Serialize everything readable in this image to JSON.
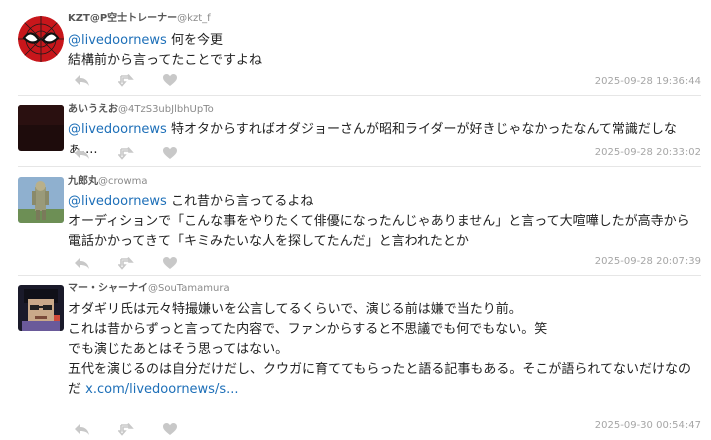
{
  "tweets": [
    {
      "name": "KZT@P空士トレーナー",
      "handle": "@kzt_f",
      "mention": "@livedoornews",
      "lines": [
        "何を今更",
        "結構前から言ってたことですよね"
      ],
      "link": "",
      "timestamp": "2025-09-28 19:36:44",
      "avatar": "spiderman-avatar"
    },
    {
      "name": "あいうえお",
      "handle": "@4TzS3ubJlbhUpTo",
      "mention": "@livedoornews",
      "lines": [
        "特オタからすればオダジョーさんが昭和ライダーが好きじゃなかったなんて常識だしなぁ...."
      ],
      "link": "",
      "timestamp": "2025-09-28 20:33:02",
      "avatar": "dark-avatar"
    },
    {
      "name": "九郎丸",
      "handle": "@crowma",
      "mention": "@livedoornews",
      "lines": [
        "これ昔から言ってるよね",
        "オーディションで「こんな事をやりたくて俳優になったんじゃありません」と言って大喧嘩したが高寺から",
        "電話かかってきて「キミみたいな人を探してたんだ」と言われたとか"
      ],
      "link": "",
      "timestamp": "2025-09-28 20:07:39",
      "avatar": "figure-avatar"
    },
    {
      "name": "マー・シャーナイ",
      "handle": "@SouTamamura",
      "mention": "",
      "lines": [
        "オダギリ氏は元々特撮嫌いを公言してるくらいで、演じる前は嫌で当たり前。",
        "これは昔からずっと言ってた内容で、ファンからすると不思議でも何でもない。笑",
        "",
        "でも演じたあとはそう思ってはない。",
        "五代を演じるのは自分だけだし、クウガに育ててもらったと語る記事もある。そこが語られてないだけなの",
        "だ"
      ],
      "link": "x.com/livedoornews/s...",
      "timestamp": "2025-09-30 00:54:47",
      "avatar": "pixel-avatar"
    }
  ]
}
